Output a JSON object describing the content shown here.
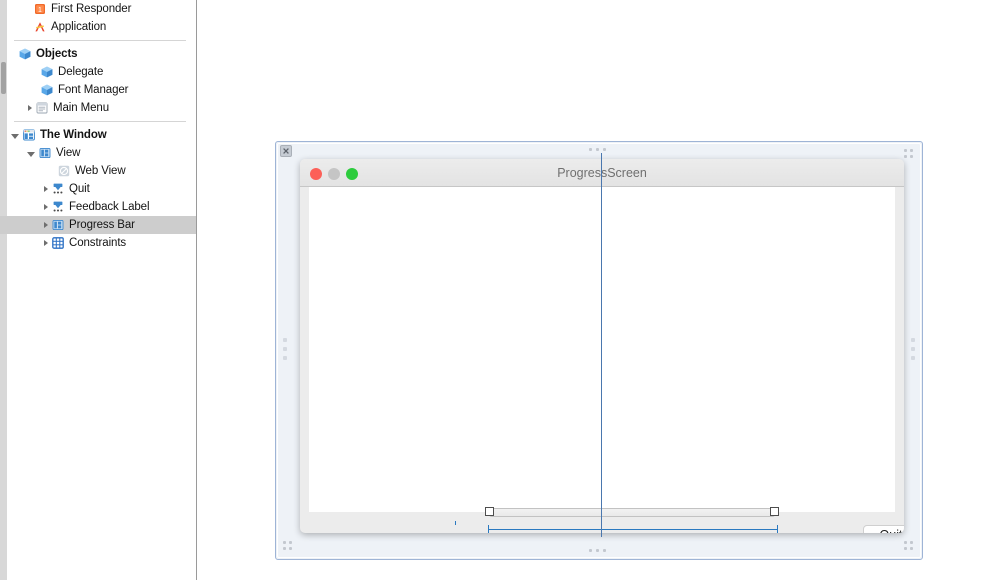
{
  "outline": {
    "rows": [
      {
        "label": "First Responder",
        "icon": "first-responder-icon",
        "indent": 33,
        "twisty": "none",
        "bold": false,
        "selected": false,
        "partial": true
      },
      {
        "label": "Application",
        "icon": "application-icon",
        "indent": 33,
        "twisty": "none",
        "bold": false,
        "selected": false
      },
      {
        "label": "Objects",
        "icon": "objects-cube-icon",
        "indent": 18,
        "twisty": "none",
        "bold": true,
        "selected": false
      },
      {
        "label": "Delegate",
        "icon": "cube-icon",
        "indent": 40,
        "twisty": "none",
        "bold": false,
        "selected": false
      },
      {
        "label": "Font Manager",
        "icon": "cube-icon",
        "indent": 40,
        "twisty": "none",
        "bold": false,
        "selected": false
      },
      {
        "label": "Main Menu",
        "icon": "menu-list-icon",
        "indent": 40,
        "twisty": "closed",
        "bold": false,
        "selected": false
      },
      {
        "label": "The Window",
        "icon": "window-icon",
        "indent": 23,
        "twisty": "open",
        "bold": true,
        "selected": false
      },
      {
        "label": "View",
        "icon": "view-icon",
        "indent": 40,
        "twisty": "open",
        "bold": false,
        "selected": false
      },
      {
        "label": "Web View",
        "icon": "web-view-icon",
        "indent": 57,
        "twisty": "none",
        "bold": false,
        "selected": false
      },
      {
        "label": "Quit",
        "icon": "constraint-node-icon",
        "indent": 57,
        "twisty": "closed",
        "bold": false,
        "selected": false
      },
      {
        "label": "Feedback Label",
        "icon": "constraint-node-icon",
        "indent": 57,
        "twisty": "closed",
        "bold": false,
        "selected": false
      },
      {
        "label": "Progress Bar",
        "icon": "progress-bar-icon",
        "indent": 57,
        "twisty": "closed",
        "bold": false,
        "selected": true
      },
      {
        "label": "Constraints",
        "icon": "constraints-grid-icon",
        "indent": 57,
        "twisty": "closed",
        "bold": false,
        "selected": false
      }
    ]
  },
  "canvas": {
    "scene_close_badge": "close-icon",
    "window": {
      "title": "ProgressScreen",
      "traffic_lights": {
        "close": "#fc6058",
        "minimize": "#c5c5c5",
        "maximize": "#2dcc3d"
      },
      "quit_button_label": "Quit"
    },
    "guides": {
      "center_guide_color": "#4a77ae",
      "constraint_color": "#2a79c0"
    },
    "selection": {
      "selected_element": "Progress Bar",
      "handle_count": 2
    }
  },
  "colors": {
    "selection_row": "#cdcdcd",
    "scene_frame_border": "#9eb4d6",
    "scene_frame_fill": "#eef2f7",
    "panel_border": "#9a9a9a"
  }
}
